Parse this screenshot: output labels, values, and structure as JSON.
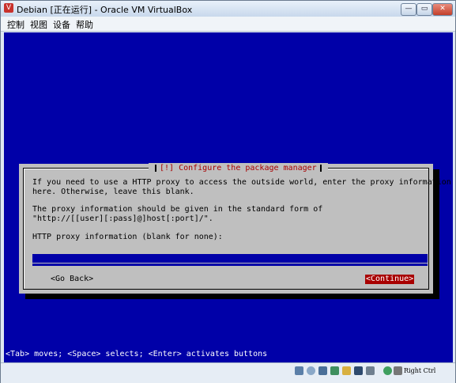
{
  "window": {
    "title": "Debian [正在运行] - Oracle VM VirtualBox"
  },
  "titlebar_buttons": {
    "minimize": "—",
    "restore": "▭",
    "close": "✕"
  },
  "menu": [
    "控制",
    "视图",
    "设备",
    "帮助"
  ],
  "dialog": {
    "title": "[!] Configure the package manager",
    "para1_line1": "If you need to use a HTTP proxy to access the outside world, enter the proxy information",
    "para1_line2": "here. Otherwise, leave this blank.",
    "para2_line1": "The proxy information should be given in the standard form of",
    "para2_line2": "\"http://[[user][:pass]@]host[:port]/\".",
    "field_label": "HTTP proxy information (blank for none):",
    "field_value": "",
    "go_back": "<Go Back>",
    "continue": "<Continue>"
  },
  "help_line": "<Tab> moves; <Space> selects; <Enter> activates buttons",
  "status": {
    "host_key": "Right Ctrl",
    "icons": [
      "hard-disk-icon",
      "optical-drive-icon",
      "usb-icon",
      "network-icon",
      "shared-folders-icon",
      "display-icon",
      "capture-icon",
      "mouse-integration-icon"
    ]
  },
  "colors": {
    "guest_bg": "#0000a8",
    "dialog_bg": "#bfbfbf",
    "title_red": "#a80000",
    "button_focus": "#a80000"
  }
}
